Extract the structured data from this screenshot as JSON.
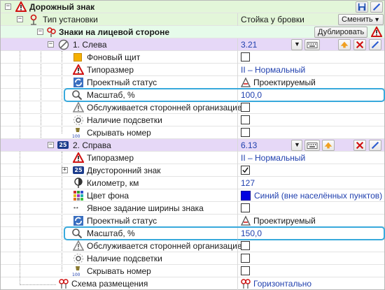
{
  "title": "Дорожный знак",
  "install": {
    "label": "Тип установки",
    "value": "Стойка у бровки",
    "button": "Сменить"
  },
  "signs_group": {
    "label": "Знаки на лицевой стороне",
    "button": "Дублировать"
  },
  "sign1": {
    "label": "1. Слева",
    "value": "3.21",
    "rows": {
      "background_shield": "Фоновый щит",
      "size_label": "Типоразмер",
      "size_value": "II – Нормальный",
      "status_label": "Проектный статус",
      "status_value": "Проектируемый",
      "scale_label": "Масштаб, %",
      "scale_value": "100,0",
      "serviced_label": "Обслуживается сторонней организацией",
      "light_label": "Наличие подсветки",
      "hide_label": "Скрывать номер"
    }
  },
  "sign2": {
    "label": "2. Справа",
    "value": "6.13",
    "badge": "25",
    "rows": {
      "size_label": "Типоразмер",
      "size_value": "II – Нормальный",
      "twosided_label": "Двусторонний знак",
      "km_label": "Километр, км",
      "km_value": "127",
      "bg_color_label": "Цвет фона",
      "bg_color_value": "Синий (вне населённых пунктов)",
      "width_label": "Явное задание ширины знака",
      "status_label": "Проектный статус",
      "status_value": "Проектируемый",
      "scale_label": "Масштаб, %",
      "scale_value": "150,0",
      "serviced_label": "Обслуживается сторонней организацией",
      "light_label": "Наличие подсветки",
      "hide_label": "Скрывать номер"
    }
  },
  "layout_row": {
    "label": "Схема размещения",
    "value": "Горизонтально"
  },
  "icons_badge_100": "100",
  "colors": {
    "accent": "#38a9dc",
    "blue_value": "#1f3fae",
    "lilac": "#e6d8f7",
    "green": "#e3f6d9",
    "bg_blue": "#0000e0",
    "orange": "#f0a020"
  }
}
